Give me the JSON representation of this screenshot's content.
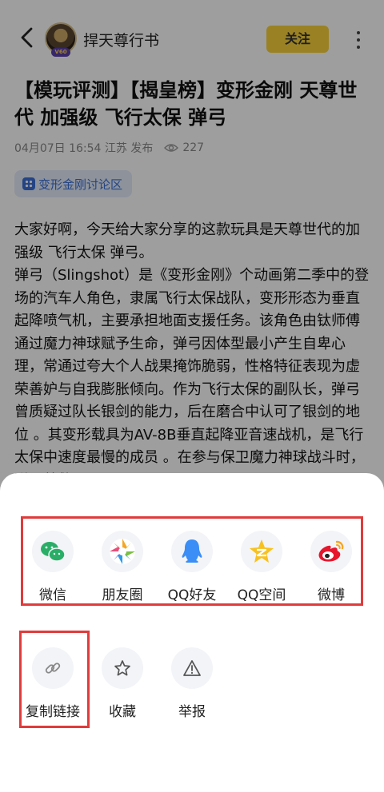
{
  "header": {
    "author": "捍天尊行书",
    "avatar_badge": "V60",
    "follow_label": "关注"
  },
  "article": {
    "title": "【模玩评测】【揭皇榜】变形金刚 天尊世代 加强级 飞行太保 弹弓",
    "meta": "04月07日 16:54 江苏 发布",
    "views": "227",
    "tag": "变形金刚讨论区",
    "body": "大家好啊，今天给大家分享的这款玩具是天尊世代的加强级 飞行太保 弹弓。\n弹弓（Slingshot）是《变形金刚》个动画第二季中的登场的汽车人角色，隶属飞行太保战队，变形形态为垂直起降喷气机，主要承担地面支援任务。该角色由钛师傅通过魔力神球赋予生命，弹弓因体型最小产生自卑心理，常通过夸大个人战果掩饰脆弱，性格特征表现为虚荣善妒与自我膨胀倾向。作为飞行太保的副队长，弹弓曾质疑过队长银剑的能力，后在磨合中认可了银剑的地位 。其变形载具为AV-8B垂直起降亚音速战机，是飞行太保中速度最慢的成员 。在参与保卫魔力神球战斗时，弹弓曾救"
  },
  "share_sheet": {
    "share_targets": [
      {
        "label": "微信",
        "icon": "wechat-icon",
        "color": "#2aae67"
      },
      {
        "label": "朋友圈",
        "icon": "moments-icon",
        "color": "#f5a623"
      },
      {
        "label": "QQ好友",
        "icon": "qq-icon",
        "color": "#3a8ef6"
      },
      {
        "label": "QQ空间",
        "icon": "qzone-icon",
        "color": "#f7c11f"
      },
      {
        "label": "微博",
        "icon": "weibo-icon",
        "color": "#e6162d"
      }
    ],
    "actions": [
      {
        "label": "复制链接",
        "icon": "link-icon"
      },
      {
        "label": "收藏",
        "icon": "star-icon"
      },
      {
        "label": "举报",
        "icon": "warning-icon"
      }
    ],
    "highlight_color": "#e03b3b"
  }
}
